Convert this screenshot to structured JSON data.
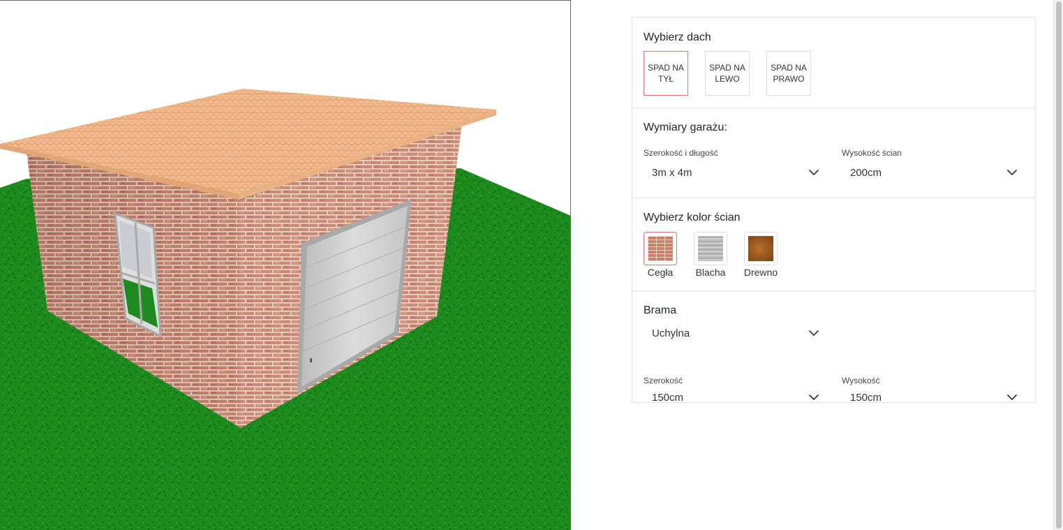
{
  "viewport": {
    "label": ""
  },
  "roof": {
    "title": "Wybierz dach",
    "options": [
      {
        "label": "SPAD NA TYŁ",
        "active": true
      },
      {
        "label": "SPAD NA LEWO",
        "active": false
      },
      {
        "label": "SPAD NA PRAWO",
        "active": false
      }
    ]
  },
  "dimensions": {
    "title": "Wymiary garażu:",
    "size": {
      "label": "Szerokość i długość",
      "value": "3m x 4m"
    },
    "height": {
      "label": "Wysokość ścian",
      "value": "200cm"
    }
  },
  "wall_color": {
    "title": "Wybierz kolor ścian",
    "options": [
      {
        "label": "Cegła",
        "texture": "brick",
        "active": true
      },
      {
        "label": "Blacha",
        "texture": "metal-sheet",
        "active": false
      },
      {
        "label": "Drewno",
        "texture": "wood",
        "active": false
      }
    ]
  },
  "gate": {
    "title": "Brama",
    "type": {
      "value": "Uchylna"
    },
    "width": {
      "label": "Szerokość",
      "value": "150cm"
    },
    "height": {
      "label": "Wysokość",
      "value": "150cm"
    }
  },
  "colors": {
    "accent": "#e57373",
    "border": "#e3e3e3",
    "grass": "#1f8a1f",
    "brick": "#c8826a",
    "roof": "#f0b880"
  },
  "icons": {
    "dropdown": "chevron-down-icon"
  }
}
